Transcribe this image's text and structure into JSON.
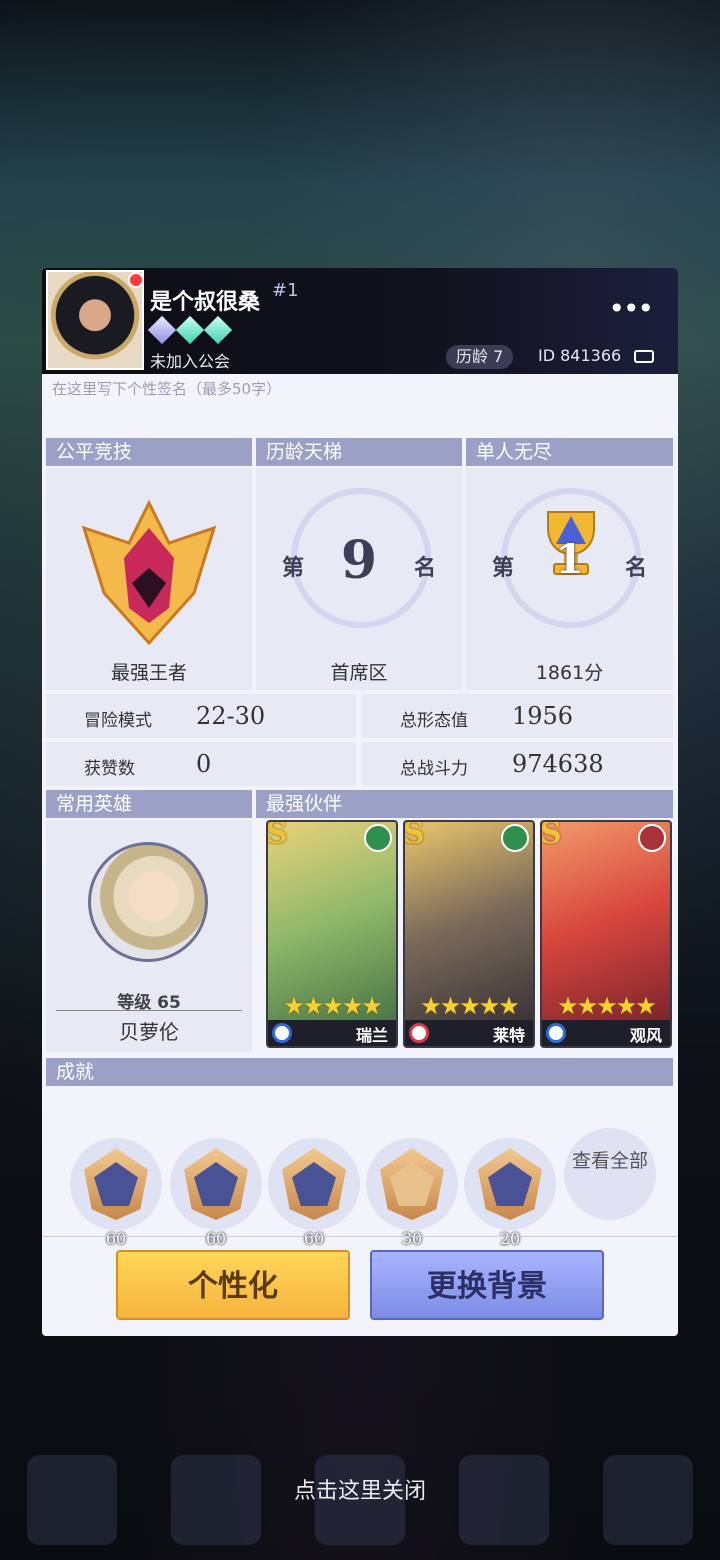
{
  "header": {
    "player_name": "是个叔很桑",
    "rank_tag": "#1",
    "guild": "未加入公会",
    "age_badge": "历龄 7",
    "id_text": "ID 841366",
    "more_label": "•••"
  },
  "signature_placeholder": "在这里写下个性签名（最多50字）",
  "ranks": {
    "fair_title": "公平竞技",
    "fair_label": "最强王者",
    "ladder_title": "历龄天梯",
    "ladder_prefix": "第",
    "ladder_rank": "9",
    "ladder_suffix": "名",
    "ladder_label": "首席区",
    "endless_title": "单人无尽",
    "endless_prefix": "第",
    "endless_rank": "1",
    "endless_suffix": "名",
    "endless_label": "1861分"
  },
  "stats": {
    "adventure_label": "冒险模式",
    "adventure_value": "22-30",
    "likes_label": "获赞数",
    "likes_value": "0",
    "form_label": "总形态值",
    "form_value": "1956",
    "power_label": "总战斗力",
    "power_value": "974638"
  },
  "common_hero": {
    "title": "常用英雄",
    "level": "等级 65",
    "name": "贝萝伦"
  },
  "partners": {
    "title": "最强伙伴",
    "cards": [
      {
        "grade": "S",
        "stars": "★★★★★",
        "name": "瑞兰",
        "element_color": "#2f8f4f",
        "class_color": "#2e6bd6"
      },
      {
        "grade": "S",
        "stars": "★★★★★",
        "name": "莱特",
        "element_color": "#2f8f4f",
        "class_color": "#d63a4a"
      },
      {
        "grade": "S",
        "stars": "★★★★★",
        "name": "观风",
        "element_color": "#a8323a",
        "class_color": "#2e6bd6"
      }
    ]
  },
  "achievements": {
    "title": "成就",
    "items": [
      {
        "count": "60"
      },
      {
        "count": "60"
      },
      {
        "count": "60"
      },
      {
        "count": "30"
      },
      {
        "count": "20"
      }
    ],
    "view_all": "查看全部"
  },
  "buttons": {
    "personalize": "个性化",
    "change_bg": "更换背景"
  },
  "close_hint": "点击这里关闭",
  "colors": {
    "section_header": "#9aa0c6",
    "cell_bg": "#e7e9f5",
    "btn_yellow": "#f6b43e",
    "btn_blue": "#7c8ce6"
  }
}
